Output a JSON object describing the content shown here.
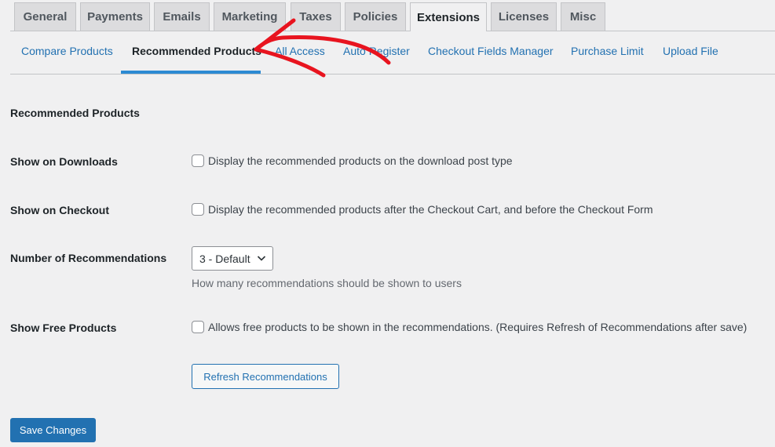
{
  "tabs": [
    {
      "label": "General"
    },
    {
      "label": "Payments"
    },
    {
      "label": "Emails"
    },
    {
      "label": "Marketing"
    },
    {
      "label": "Taxes"
    },
    {
      "label": "Policies"
    },
    {
      "label": "Extensions",
      "active": true
    },
    {
      "label": "Licenses"
    },
    {
      "label": "Misc"
    }
  ],
  "subtabs": [
    {
      "label": "Compare Products"
    },
    {
      "label": "Recommended Products",
      "active": true
    },
    {
      "label": "All Access"
    },
    {
      "label": "Auto Register"
    },
    {
      "label": "Checkout Fields Manager"
    },
    {
      "label": "Purchase Limit"
    },
    {
      "label": "Upload File"
    }
  ],
  "section": {
    "title": "Recommended Products"
  },
  "settings": {
    "show_downloads": {
      "label": "Show on Downloads",
      "checkbox_text": "Display the recommended products on the download post type",
      "checked": false
    },
    "show_checkout": {
      "label": "Show on Checkout",
      "checkbox_text": "Display the recommended products after the Checkout Cart, and before the Checkout Form",
      "checked": false
    },
    "number": {
      "label": "Number of Recommendations",
      "selected": "3 - Default",
      "description": "How many recommendations should be shown to users"
    },
    "free_products": {
      "label": "Show Free Products",
      "checkbox_text": "Allows free products to be shown in the recommendations. (Requires Refresh of Recommendations after save)",
      "checked": false
    }
  },
  "buttons": {
    "refresh": "Refresh Recommendations",
    "save": "Save Changes"
  },
  "colors": {
    "link": "#2271b1",
    "primary": "#2271b1",
    "active_underline": "#2c8ad3",
    "annotation_arrow": "#e8141f"
  }
}
